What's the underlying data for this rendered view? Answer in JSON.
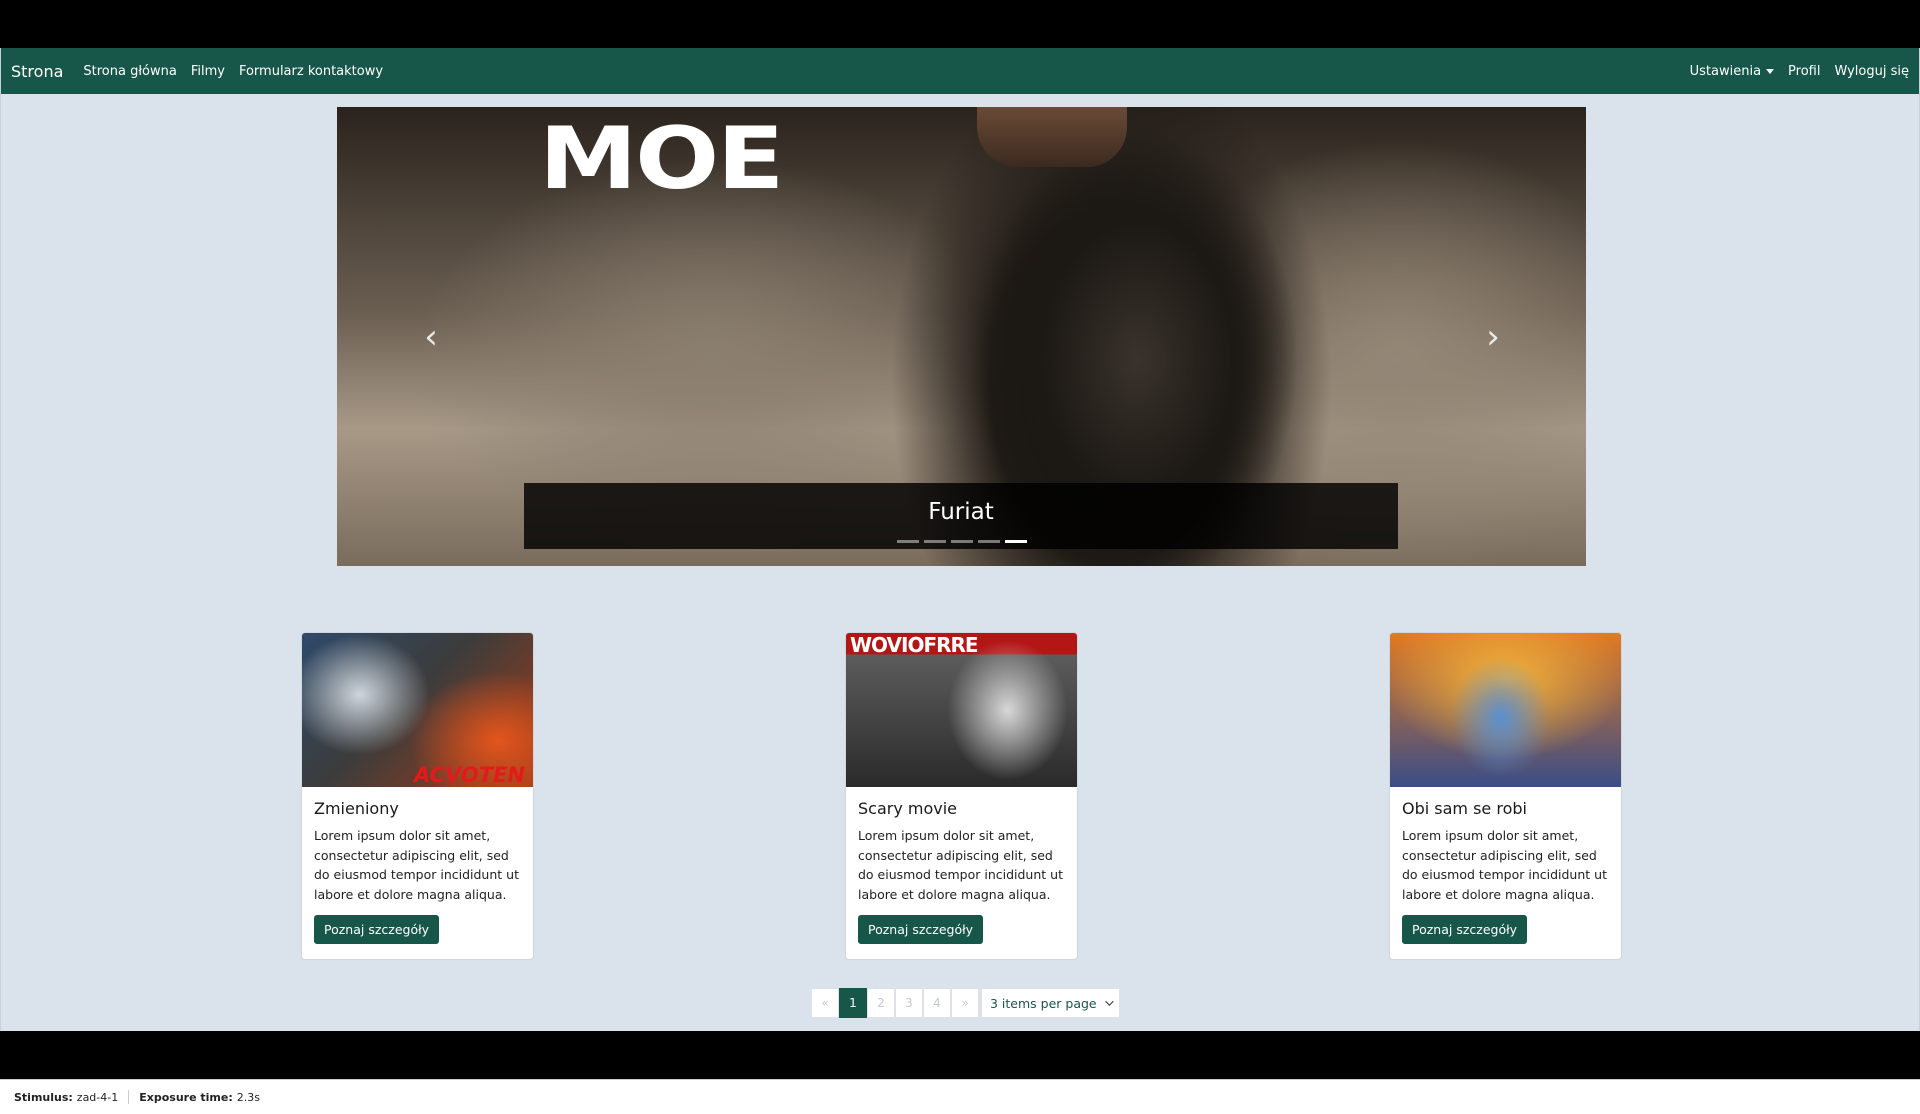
{
  "navbar": {
    "brand": "Strona",
    "links": [
      "Strona główna",
      "Filmy",
      "Formularz kontaktowy"
    ],
    "right": {
      "settings": "Ustawienia",
      "profile": "Profil",
      "logout": "Wyloguj się"
    }
  },
  "carousel": {
    "logo_text": "MOE",
    "caption": "Furiat",
    "prev_icon": "‹",
    "next_icon": "›",
    "indicator_count": 5,
    "active_indicator": 5
  },
  "cards": [
    {
      "title": "Zmieniony",
      "text": "Lorem ipsum dolor sit amet, consectetur adipiscing elit, sed do eiusmod tempor incididunt ut labore et dolore magna aliqua.",
      "button": "Poznaj szczegóły",
      "poster_text": "ACVOTEN"
    },
    {
      "title": "Scary movie",
      "text": "Lorem ipsum dolor sit amet, consectetur adipiscing elit, sed do eiusmod tempor incididunt ut labore et dolore magna aliqua.",
      "button": "Poznaj szczegóły",
      "poster_text": "WOVIOFRRE"
    },
    {
      "title": "Obi sam se robi",
      "text": "Lorem ipsum dolor sit amet, consectetur adipiscing elit, sed do eiusmod tempor incididunt ut labore et dolore magna aliqua.",
      "button": "Poznaj szczegóły",
      "poster_text": ""
    }
  ],
  "pagination": {
    "prev": "«",
    "pages": [
      "1",
      "2",
      "3",
      "4"
    ],
    "active_page": "1",
    "next": "»",
    "per_page": "3 items per page"
  },
  "status_bar": {
    "stimulus_label": "Stimulus:",
    "stimulus_value": "zad-4-1",
    "exposure_label": "Exposure time:",
    "exposure_value": "2.3s"
  },
  "colors": {
    "navbar": "#175749",
    "accent": "#175749",
    "page_bg": "#dae3ec"
  }
}
